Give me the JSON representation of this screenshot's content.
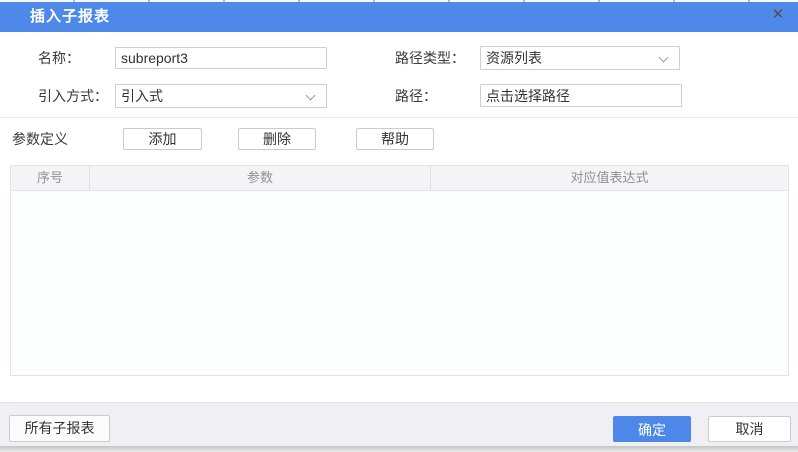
{
  "dialog": {
    "title": "插入子报表",
    "close_icon": "✕"
  },
  "form": {
    "name_label": "名称：",
    "name_value": "subreport3",
    "path_type_label": "路径类型：",
    "path_type_value": "资源列表",
    "import_mode_label": "引入方式：",
    "import_mode_value": "引入式",
    "path_label": "路径：",
    "path_value": "点击选择路径"
  },
  "params": {
    "section_label": "参数定义",
    "add_label": "添加",
    "delete_label": "删除",
    "help_label": "帮助"
  },
  "table": {
    "columns": [
      "序号",
      "参数",
      "对应值表达式"
    ],
    "rows": []
  },
  "footer": {
    "all_subreports_label": "所有子报表",
    "ok_label": "确定",
    "cancel_label": "取消"
  },
  "colors": {
    "titlebar": "#4e89e9",
    "primary_button": "#4d87e8",
    "table_header_bg": "#f4f4f6",
    "footer_bg": "#f0f0f4",
    "input_border": "#cfcfcf"
  }
}
